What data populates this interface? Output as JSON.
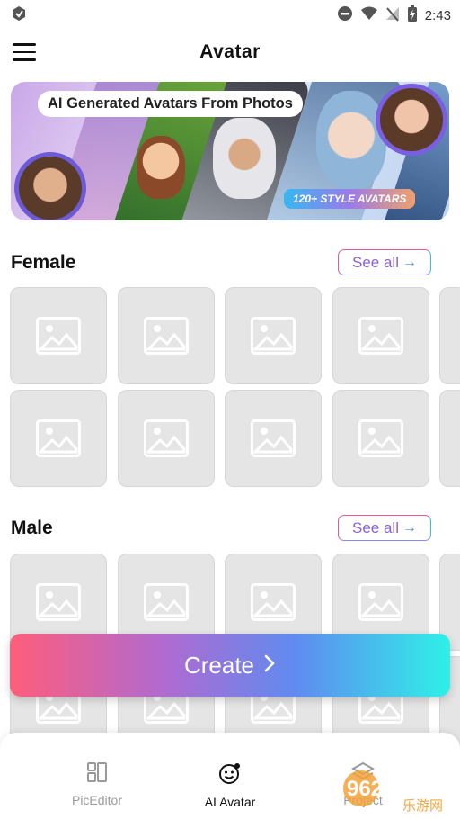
{
  "status_bar": {
    "time": "2:43"
  },
  "app_bar": {
    "title": "Avatar"
  },
  "banner": {
    "headline": "AI Generated Avatars From Photos",
    "tag": "120+ STYLE AVATARS"
  },
  "sections": {
    "female": {
      "title": "Female",
      "see_all": "See all"
    },
    "male": {
      "title": "Male",
      "see_all": "See all"
    }
  },
  "create_button": {
    "label": "Create"
  },
  "bottom_nav": {
    "items": [
      {
        "label": "PicEditor",
        "icon": "layout-icon",
        "active": false
      },
      {
        "label": "AI Avatar",
        "icon": "smiley-face-icon",
        "active": true
      },
      {
        "label": "Project",
        "icon": "layers-icon",
        "active": false
      }
    ]
  },
  "watermark": {
    "text": "962.NET",
    "subtext": "乐游网"
  },
  "colors": {
    "accent_pink": "#ff5d7b",
    "accent_cyan": "#2ff0e8",
    "tile_bg": "#e5e5e5"
  }
}
